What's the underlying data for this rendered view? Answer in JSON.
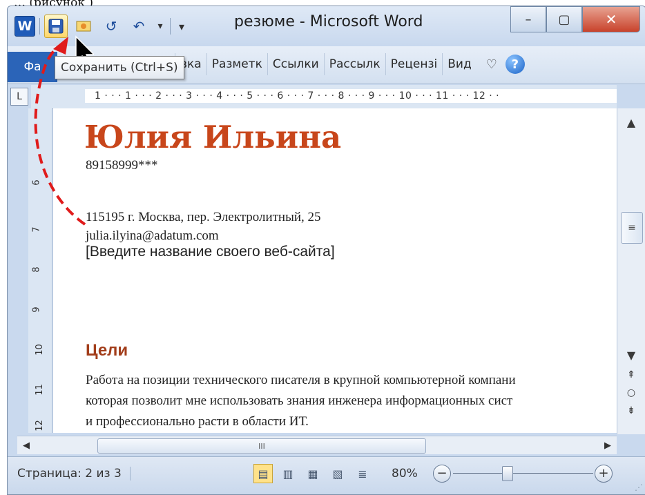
{
  "caption": "…                      (рисунок      )",
  "window": {
    "title": "резюме - Microsoft Word",
    "accent": "#2b64b8"
  },
  "qat": {
    "word_icon": "W",
    "save_icon": "save-icon",
    "undo_icon": "↶",
    "redo_icon": "↺",
    "dropdown_icon": "▾"
  },
  "window_controls": {
    "minimize": "–",
    "maximize": "▢",
    "close": "✕"
  },
  "ribbon": {
    "file_tab": "Фа",
    "tabs": [
      "вка",
      "Разметк",
      "Ссылки",
      "Рассылк",
      "Рецензі",
      "Вид"
    ],
    "heart_icon": "♡",
    "help_icon": "?"
  },
  "tooltip": "Сохранить (Ctrl+S)",
  "ruler": {
    "corner": "L",
    "top_labels": "1 · · · 1 · · · 2 · · · 3 · · · 4 · · · 5 · · · 6 · · · 7 · · · 8 · · · 9 · · · 10 · · · 11 · · · 12 · ·",
    "left_labels": [
      "6",
      "7",
      "8",
      "9",
      "10",
      "11",
      "12"
    ]
  },
  "document": {
    "name": "Юлия Ильина",
    "phone": "89158999***",
    "address": "115195 г. Москва, пер. Электролитный, 25",
    "email": "julia.ilyina@adatum.com",
    "website_placeholder": "[Введите название своего веб-сайта]",
    "heading": "Цели",
    "paragraph": [
      "Работа на позиции технического писателя в крупной компьютерной компани",
      "которая позволит мне использовать знания инженера  информационных сист",
      "и профессионально расти в области ИТ."
    ],
    "name_color": "#c8461b",
    "heading_color": "#a23d1a"
  },
  "vscroll": {
    "up": "▲",
    "thumb": "≡",
    "down": "▼",
    "prev": "⇞",
    "browse": "○",
    "next": "⇟"
  },
  "hscroll": {
    "left": "◀",
    "thumb": "III",
    "right": "▶"
  },
  "statusbar": {
    "page_info": "Страница: 2 из 3",
    "view_icons": [
      "▤",
      "▥",
      "▦",
      "▧",
      "≣"
    ],
    "zoom": "80%",
    "zoom_minus": "−",
    "zoom_plus": "+",
    "zoom_level_percent": 80,
    "grip": "⋰"
  }
}
